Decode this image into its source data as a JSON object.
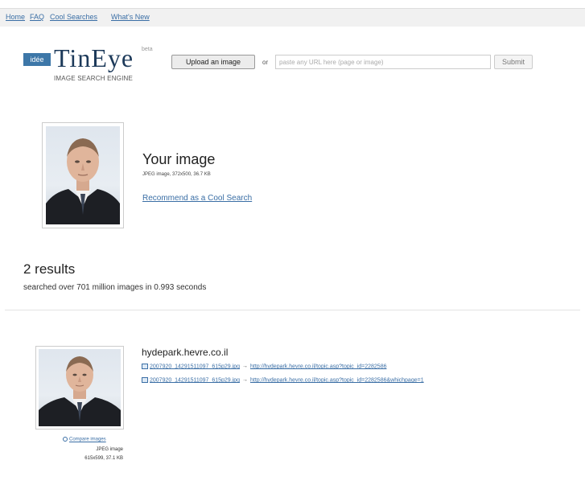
{
  "nav": {
    "items": [
      "Home",
      "FAQ",
      "Cool Searches",
      "What's New"
    ]
  },
  "header": {
    "logo_box": "idée",
    "logo_text": "TinEye",
    "beta": "beta",
    "tagline": "IMAGE SEARCH ENGINE",
    "upload_label": "Upload an image",
    "or_label": "or",
    "url_placeholder": "paste any URL here (page or image)",
    "submit_label": "Submit"
  },
  "your_image": {
    "title": "Your image",
    "meta": "JPEG image, 372x500, 36.7 KB",
    "recommend": "Recommend as a Cool Search"
  },
  "results": {
    "count": "2 results",
    "summary": "searched over 701 million images in 0.993 seconds"
  },
  "result_items": [
    {
      "domain": "hydepark.hevre.co.il",
      "matches": [
        {
          "file": "2007920_14291511097_615p29.jpg",
          "arrow": "→",
          "url": "http://hydepark.hevre.co.il/topic.asp?topic_id=2282586"
        },
        {
          "file": "2007920_14291511097_615p29.jpg",
          "arrow": "→",
          "url": "http://hydepark.hevre.co.il/topic.asp?topic_id=2282586&whichpage=1"
        }
      ],
      "compare": "Compare images",
      "type": "JPEG image",
      "size": "615x599, 37.1 KB"
    }
  ]
}
